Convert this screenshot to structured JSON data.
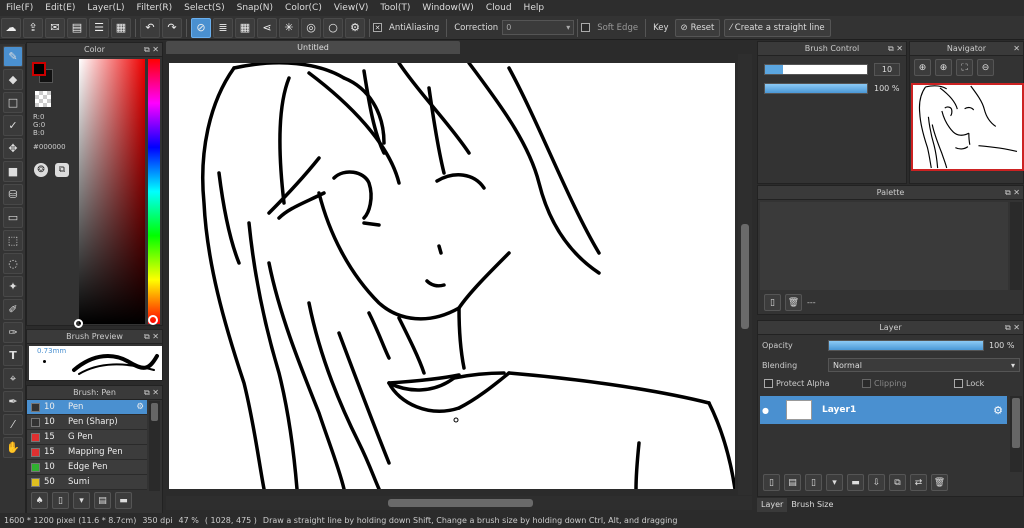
{
  "menu": [
    "File(F)",
    "Edit(E)",
    "Layer(L)",
    "Filter(R)",
    "Select(S)",
    "Snap(N)",
    "Color(C)",
    "View(V)",
    "Tool(T)",
    "Window(W)",
    "Cloud",
    "Help"
  ],
  "toolbar": {
    "antialiasing_label": "AntiAliasing",
    "correction_label": "Correction",
    "correction_value": "0",
    "soft_edge_label": "Soft Edge",
    "key_label": "Key",
    "reset_label": "Reset",
    "straight_line_label": "Create a straight line"
  },
  "color_panel": {
    "title": "Color",
    "r": "R:0",
    "g": "G:0",
    "b": "B:0",
    "hex": "#000000",
    "foreground": "#000000",
    "accent": "#cc0000"
  },
  "brush_preview": {
    "title": "Brush Preview",
    "size": "0.73mm"
  },
  "brush_panel": {
    "title": "Brush: Pen",
    "items": [
      {
        "size": "10",
        "name": "Pen",
        "color": "#333333",
        "selected": true
      },
      {
        "size": "10",
        "name": "Pen (Sharp)",
        "color": "#333333"
      },
      {
        "size": "15",
        "name": "G Pen",
        "color": "#e03030"
      },
      {
        "size": "15",
        "name": "Mapping Pen",
        "color": "#e03030"
      },
      {
        "size": "10",
        "name": "Edge Pen",
        "color": "#30b030"
      },
      {
        "size": "50",
        "name": "Sumi",
        "color": "#e0c020"
      }
    ]
  },
  "canvas": {
    "tab_title": "Untitled"
  },
  "brush_control": {
    "title": "Brush Control",
    "size_value": "10",
    "opacity_value": "100 %"
  },
  "navigator": {
    "title": "Navigator"
  },
  "palette": {
    "title": "Palette",
    "footer": "---"
  },
  "layer_panel": {
    "title": "Layer",
    "opacity_label": "Opacity",
    "opacity_value": "100 %",
    "blending_label": "Blending",
    "blending_value": "Normal",
    "protect_alpha": "Protect Alpha",
    "clipping": "Clipping",
    "lock": "Lock",
    "layer_name": "Layer1"
  },
  "bottom_tabs": [
    "Layer",
    "Brush Size"
  ],
  "status": {
    "dimensions": "1600 * 1200 pixel",
    "physical": "(11.6 * 8.7cm)",
    "dpi": "350 dpi",
    "zoom": "47 %",
    "coords": "( 1028, 475 )",
    "hint": "Draw a straight line by holding down Shift, Change a brush size by holding down Ctrl, Alt, and dragging"
  }
}
